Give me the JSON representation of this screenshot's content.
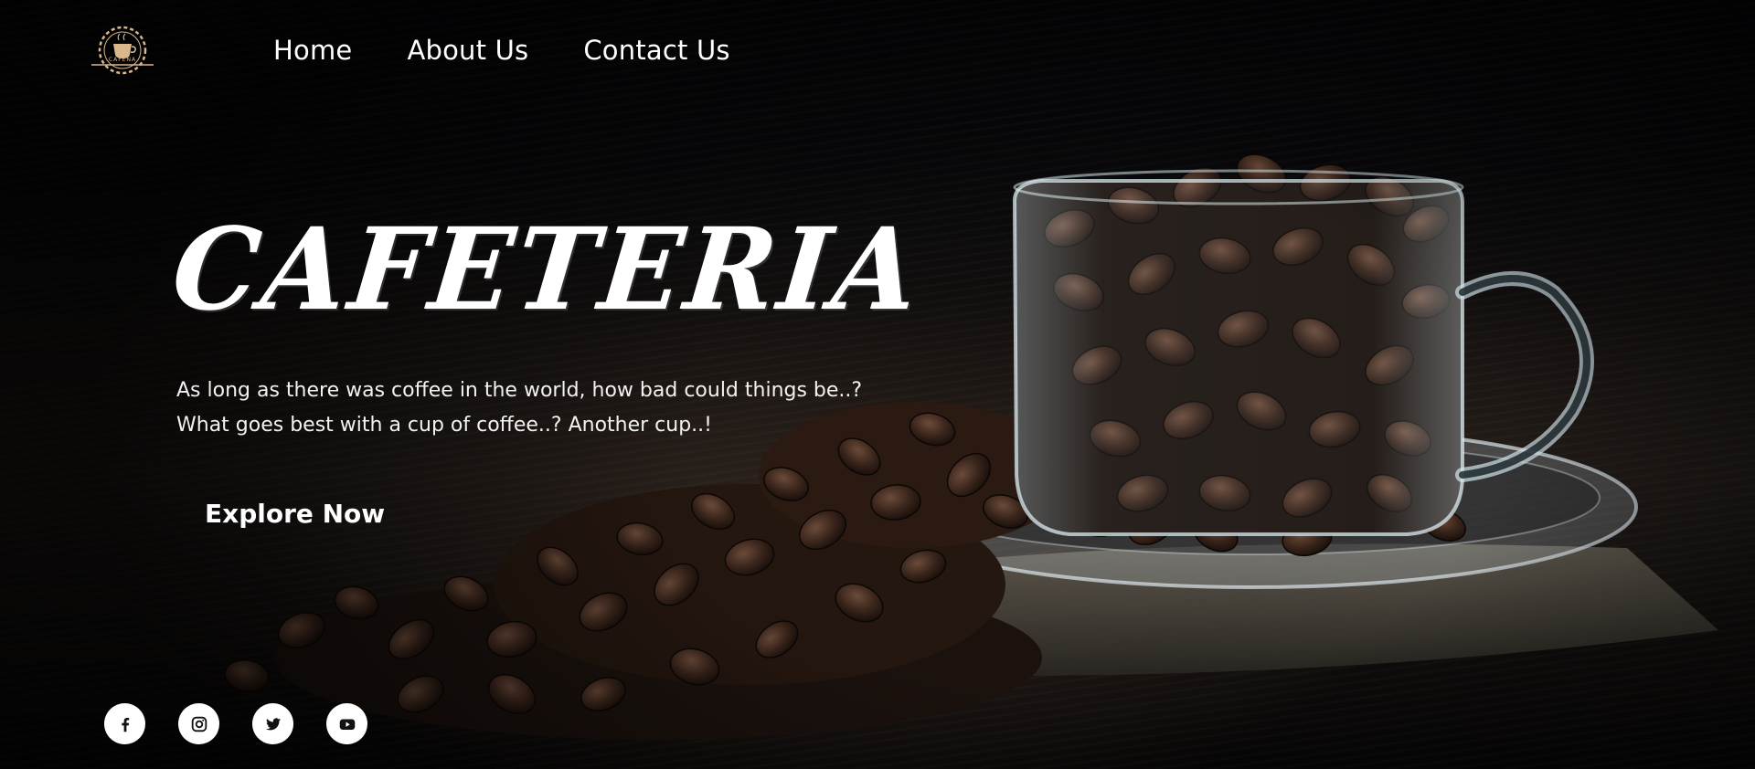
{
  "brand": {
    "logo_text": "CAFENA"
  },
  "nav": {
    "items": [
      "Home",
      "About Us",
      "Contact Us"
    ]
  },
  "hero": {
    "title": "Cafeteria",
    "tagline": [
      "As long as there was coffee in the world, how bad could things be..?",
      "What goes best with a cup of coffee..? Another cup..!"
    ],
    "cta": "Explore Now"
  },
  "social": {
    "icons": [
      "facebook-icon",
      "instagram-icon",
      "twitter-icon",
      "youtube-icon"
    ]
  },
  "colors": {
    "background": "#060608",
    "text": "#ffffff",
    "logo_accent": "#d9b88c",
    "icon_circle": "#ffffff"
  }
}
